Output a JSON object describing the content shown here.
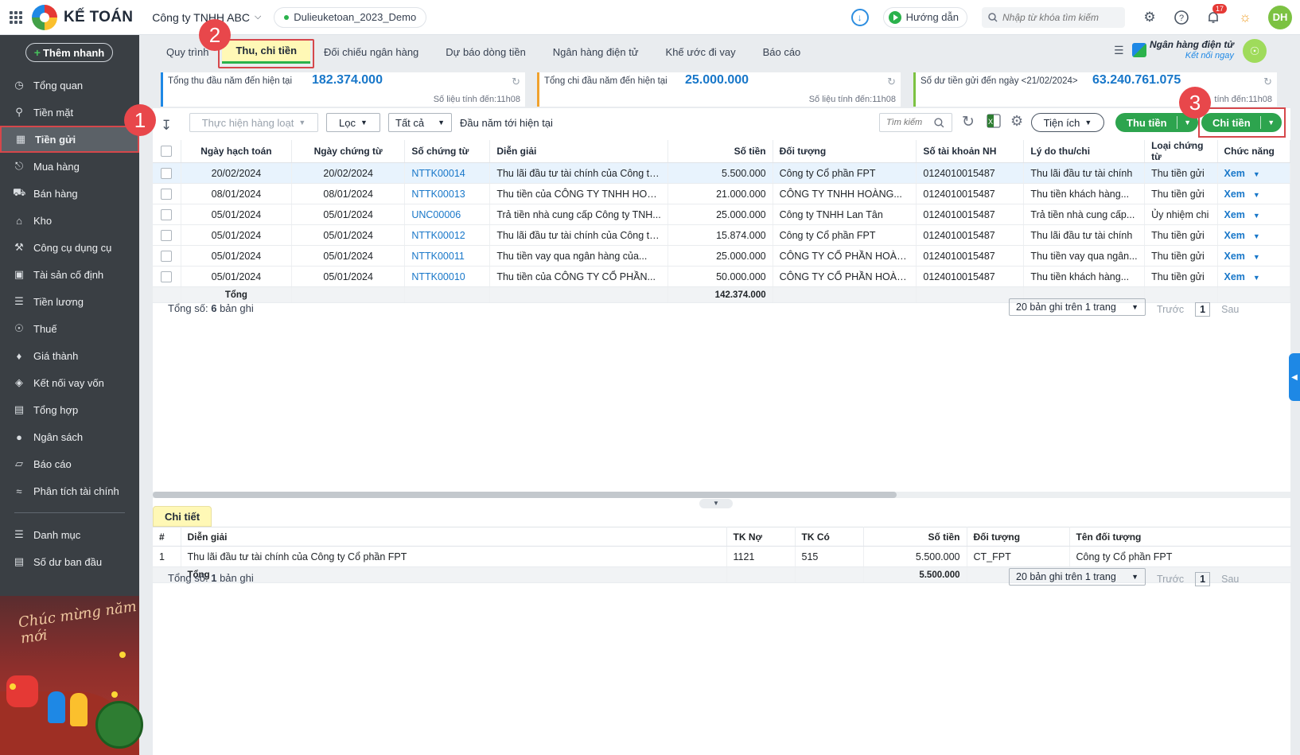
{
  "topbar": {
    "brand": "KẾ TOÁN",
    "company": "Công ty TNHH ABC",
    "database": "Dulieuketoan_2023_Demo",
    "guide_label": "Hướng dẫn",
    "search_placeholder": "Nhập từ khóa tìm kiếm",
    "notification_count": "17",
    "avatar_initials": "DH"
  },
  "sidebar": {
    "quick_add": "Thêm nhanh",
    "items": [
      {
        "label": "Tổng quan",
        "icon": "dashboard-icon"
      },
      {
        "label": "Tiền mặt",
        "icon": "cash-icon"
      },
      {
        "label": "Tiền gửi",
        "icon": "bank-icon"
      },
      {
        "label": "Mua hàng",
        "icon": "shopping-bag-icon"
      },
      {
        "label": "Bán hàng",
        "icon": "cart-icon"
      },
      {
        "label": "Kho",
        "icon": "warehouse-icon"
      },
      {
        "label": "Công cụ dụng cụ",
        "icon": "tools-icon"
      },
      {
        "label": "Tài sản cố định",
        "icon": "asset-icon"
      },
      {
        "label": "Tiền lương",
        "icon": "payroll-icon"
      },
      {
        "label": "Thuế",
        "icon": "tax-icon"
      },
      {
        "label": "Giá thành",
        "icon": "price-tag-icon"
      },
      {
        "label": "Kết nối vay vốn",
        "icon": "loan-icon"
      },
      {
        "label": "Tổng hợp",
        "icon": "ledger-icon"
      },
      {
        "label": "Ngân sách",
        "icon": "budget-icon"
      },
      {
        "label": "Báo cáo",
        "icon": "report-icon"
      },
      {
        "label": "Phân tích tài chính",
        "icon": "analysis-icon"
      }
    ],
    "bottom_items": [
      {
        "label": "Danh mục",
        "icon": "list-icon"
      },
      {
        "label": "Số dư ban đầu",
        "icon": "opening-balance-icon"
      }
    ],
    "banner_text": "Chúc mừng năm mới"
  },
  "tabs": [
    "Quy trình",
    "Thu, chi tiền",
    "Đối chiếu ngân hàng",
    "Dự báo dòng tiền",
    "Ngân hàng điện tử",
    "Khế ước đi vay",
    "Báo cáo"
  ],
  "ebank": {
    "title": "Ngân hàng điện tử",
    "link": "Kết nối ngay"
  },
  "stats": [
    {
      "label": "Tổng thu đầu năm đến hiện tại",
      "value": "182.374.000",
      "updated": "Số liệu tính đến:11h08"
    },
    {
      "label": "Tổng chi đầu năm đến hiện tại",
      "value": "25.000.000",
      "updated": "Số liệu tính đến:11h08"
    },
    {
      "label": "Số dư tiền gửi đến ngày <21/02/2024>",
      "value": "63.240.761.075",
      "updated": "tính đến:11h08"
    }
  ],
  "toolbar": {
    "bulk_action": "Thực hiện hàng loạt",
    "filter": "Lọc",
    "scope": "Tất cả",
    "period": "Đầu năm tới hiện tại",
    "search_placeholder": "Tìm kiếm",
    "utilities": "Tiện ích",
    "receive": "Thu tiền",
    "pay": "Chi tiền"
  },
  "grid": {
    "headers": [
      "Ngày hạch toán",
      "Ngày chứng từ",
      "Số chứng từ",
      "Diễn giải",
      "Số tiền",
      "Đối tượng",
      "Số tài khoản NH",
      "Lý do thu/chi",
      "Loại chứng từ",
      "Chức năng"
    ],
    "rows": [
      {
        "posting_date": "20/02/2024",
        "doc_date": "20/02/2024",
        "doc_no": "NTTK00014",
        "desc": "Thu lãi đầu tư tài chính của Công ty...",
        "amount": "5.500.000",
        "party": "Công ty Cổ phần FPT",
        "account": "0124010015487",
        "reason": "Thu lãi đầu tư tài chính",
        "doc_type": "Thu tiền gửi",
        "action": "Xem"
      },
      {
        "posting_date": "08/01/2024",
        "doc_date": "08/01/2024",
        "doc_no": "NTTK00013",
        "desc": "Thu tiền của CÔNG TY TNHH HOÀN...",
        "amount": "21.000.000",
        "party": "CÔNG TY TNHH HOÀNG...",
        "account": "0124010015487",
        "reason": "Thu tiền khách hàng...",
        "doc_type": "Thu tiền gửi",
        "action": "Xem"
      },
      {
        "posting_date": "05/01/2024",
        "doc_date": "05/01/2024",
        "doc_no": "UNC00006",
        "desc": "Trả tiền nhà cung cấp Công ty TNH...",
        "amount": "25.000.000",
        "party": "Công ty TNHH Lan Tân",
        "account": "0124010015487",
        "reason": "Trả tiền nhà cung cấp...",
        "doc_type": "Ủy nhiệm chi",
        "action": "Xem"
      },
      {
        "posting_date": "05/01/2024",
        "doc_date": "05/01/2024",
        "doc_no": "NTTK00012",
        "desc": "Thu lãi đầu tư tài chính của Công ty...",
        "amount": "15.874.000",
        "party": "Công ty Cổ phần FPT",
        "account": "0124010015487",
        "reason": "Thu lãi đầu tư tài chính",
        "doc_type": "Thu tiền gửi",
        "action": "Xem"
      },
      {
        "posting_date": "05/01/2024",
        "doc_date": "05/01/2024",
        "doc_no": "NTTK00011",
        "desc": "Thu tiền vay qua ngân hàng của...",
        "amount": "25.000.000",
        "party": "CÔNG TY CỔ PHẦN HOÀNG...",
        "account": "0124010015487",
        "reason": "Thu tiền vay qua ngân...",
        "doc_type": "Thu tiền gửi",
        "action": "Xem"
      },
      {
        "posting_date": "05/01/2024",
        "doc_date": "05/01/2024",
        "doc_no": "NTTK00010",
        "desc": "Thu tiền của CÔNG TY CỔ PHẦN...",
        "amount": "50.000.000",
        "party": "CÔNG TY CỔ PHẦN HOÀNG...",
        "account": "0124010015487",
        "reason": "Thu tiền khách hàng...",
        "doc_type": "Thu tiền gửi",
        "action": "Xem"
      }
    ],
    "total_label": "Tổng",
    "total_amount": "142.374.000"
  },
  "pagination": {
    "count_prefix": "Tổng số:",
    "count": "6",
    "count_suffix": "bản ghi",
    "page_size": "20 bản ghi trên 1 trang",
    "prev": "Trước",
    "page": "1",
    "next": "Sau"
  },
  "detail": {
    "tab": "Chi tiết",
    "headers": [
      "#",
      "Diễn giải",
      "TK Nợ",
      "TK Có",
      "Số tiền",
      "Đối tượng",
      "Tên đối tượng"
    ],
    "rows": [
      {
        "no": "1",
        "desc": "Thu lãi đầu tư tài chính của Công ty Cổ phần FPT",
        "debit": "1121",
        "credit": "515",
        "amount": "5.500.000",
        "party": "CT_FPT",
        "party_name": "Công ty Cổ phần FPT"
      }
    ],
    "total_label": "Tổng",
    "total_amount": "5.500.000",
    "count": "1"
  },
  "callouts": [
    "1",
    "2",
    "3"
  ],
  "colors": {
    "primary_green": "#2da44e",
    "link_blue": "#1877c9",
    "highlight_red": "#d6474b",
    "sidebar_bg": "#3a3f44",
    "tab_active_bg": "#fff8b6"
  }
}
